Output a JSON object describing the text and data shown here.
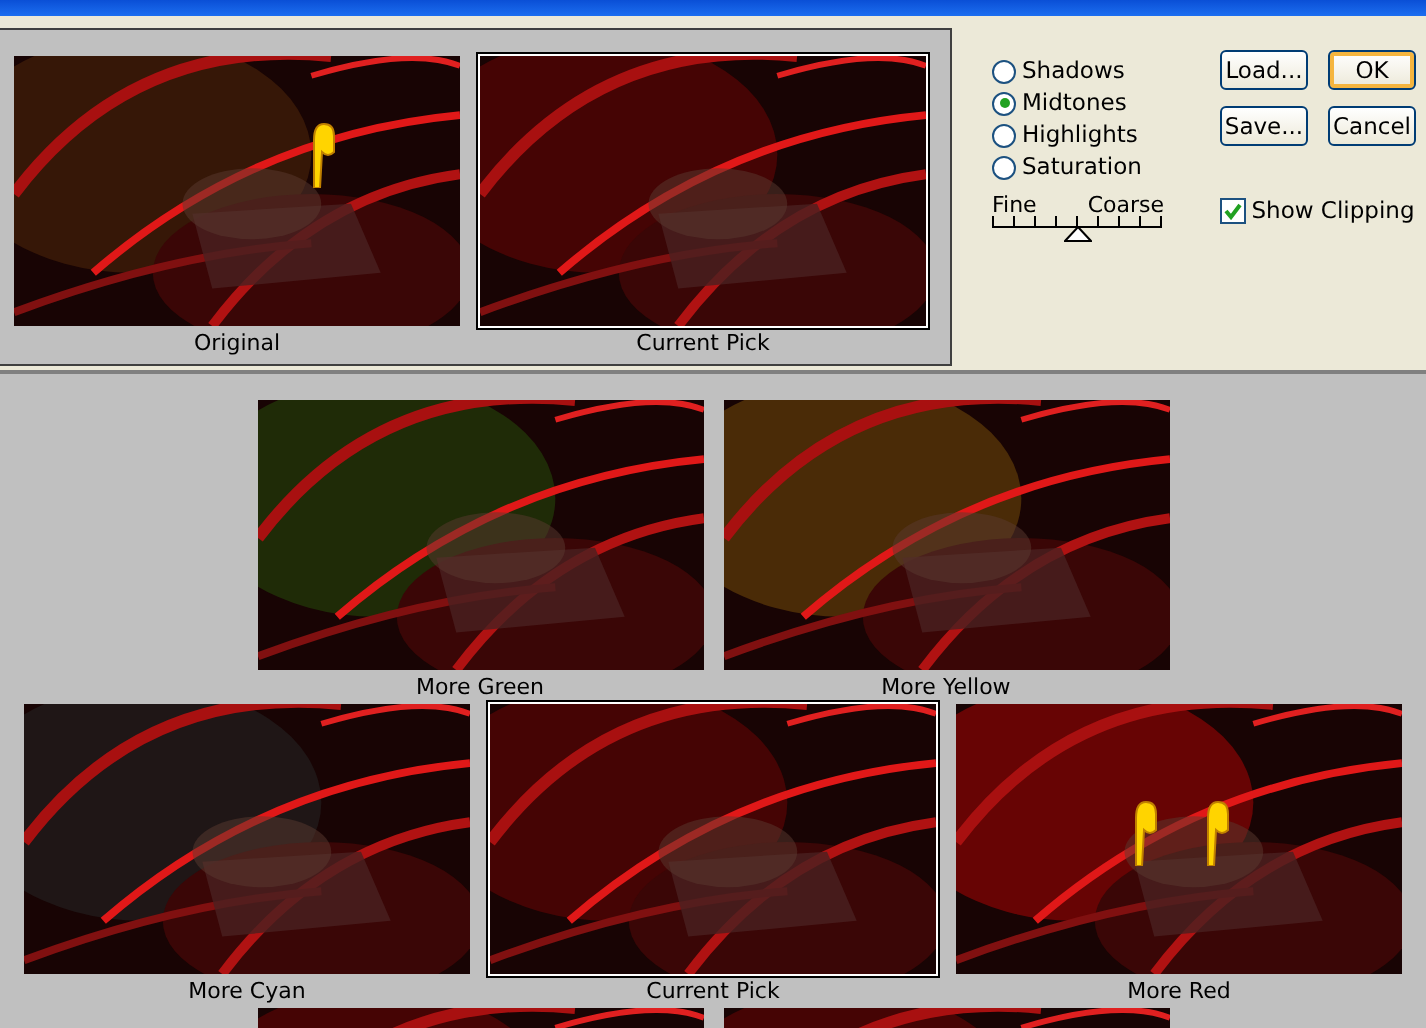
{
  "preview": [
    {
      "label": "Original",
      "selected": false,
      "cursors": [
        {
          "kind": "hand"
        }
      ]
    },
    {
      "label": "Current Pick",
      "selected": true
    }
  ],
  "tones": [
    {
      "label": "Shadows",
      "selected": false
    },
    {
      "label": "Midtones",
      "selected": true
    },
    {
      "label": "Highlights",
      "selected": false
    },
    {
      "label": "Saturation",
      "selected": false
    }
  ],
  "slider": {
    "fine": "Fine",
    "coarse": "Coarse",
    "level": 0.5
  },
  "buttons": [
    {
      "label": "Load...",
      "default": false
    },
    {
      "label": "OK",
      "default": true
    },
    {
      "label": "Save...",
      "default": false
    },
    {
      "label": "Cancel",
      "default": false
    }
  ],
  "show_clipping": {
    "label": "Show Clipping",
    "checked": true
  },
  "variations": [
    {
      "items": [
        {
          "kind": "thumbnail",
          "label": "More Green",
          "selected": false
        },
        {
          "kind": "thumbnail",
          "label": "More Yellow",
          "selected": false
        }
      ]
    },
    {
      "items": [
        {
          "kind": "thumbnail",
          "label": "More Cyan",
          "selected": false
        },
        {
          "kind": "thumbnail",
          "label": "Current Pick",
          "selected": true
        },
        {
          "kind": "thumbnail",
          "label": "More Red",
          "selected": false,
          "cursors": [
            {
              "kind": "hand"
            },
            {
              "kind": "hand"
            }
          ]
        }
      ]
    },
    {
      "items": [
        {
          "kind": "picture"
        },
        {
          "kind": "picture"
        }
      ]
    }
  ]
}
